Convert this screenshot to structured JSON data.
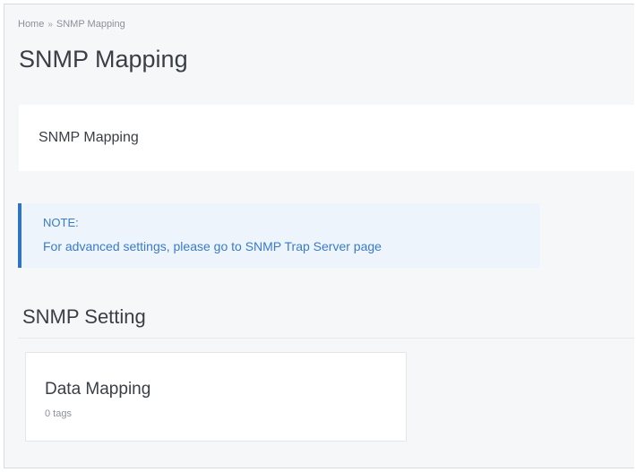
{
  "breadcrumb": {
    "home": "Home",
    "separator": "»",
    "current": "SNMP Mapping"
  },
  "page_title": "SNMP Mapping",
  "mapping_card": {
    "label": "SNMP Mapping"
  },
  "note": {
    "heading": "NOTE:",
    "message": "For advanced settings, please go to SNMP Trap Server page",
    "accent_color": "#2f74c0"
  },
  "snmp_setting": {
    "title": "SNMP Setting",
    "cards": [
      {
        "title": "Data Mapping",
        "subtitle": "0 tags"
      }
    ]
  }
}
